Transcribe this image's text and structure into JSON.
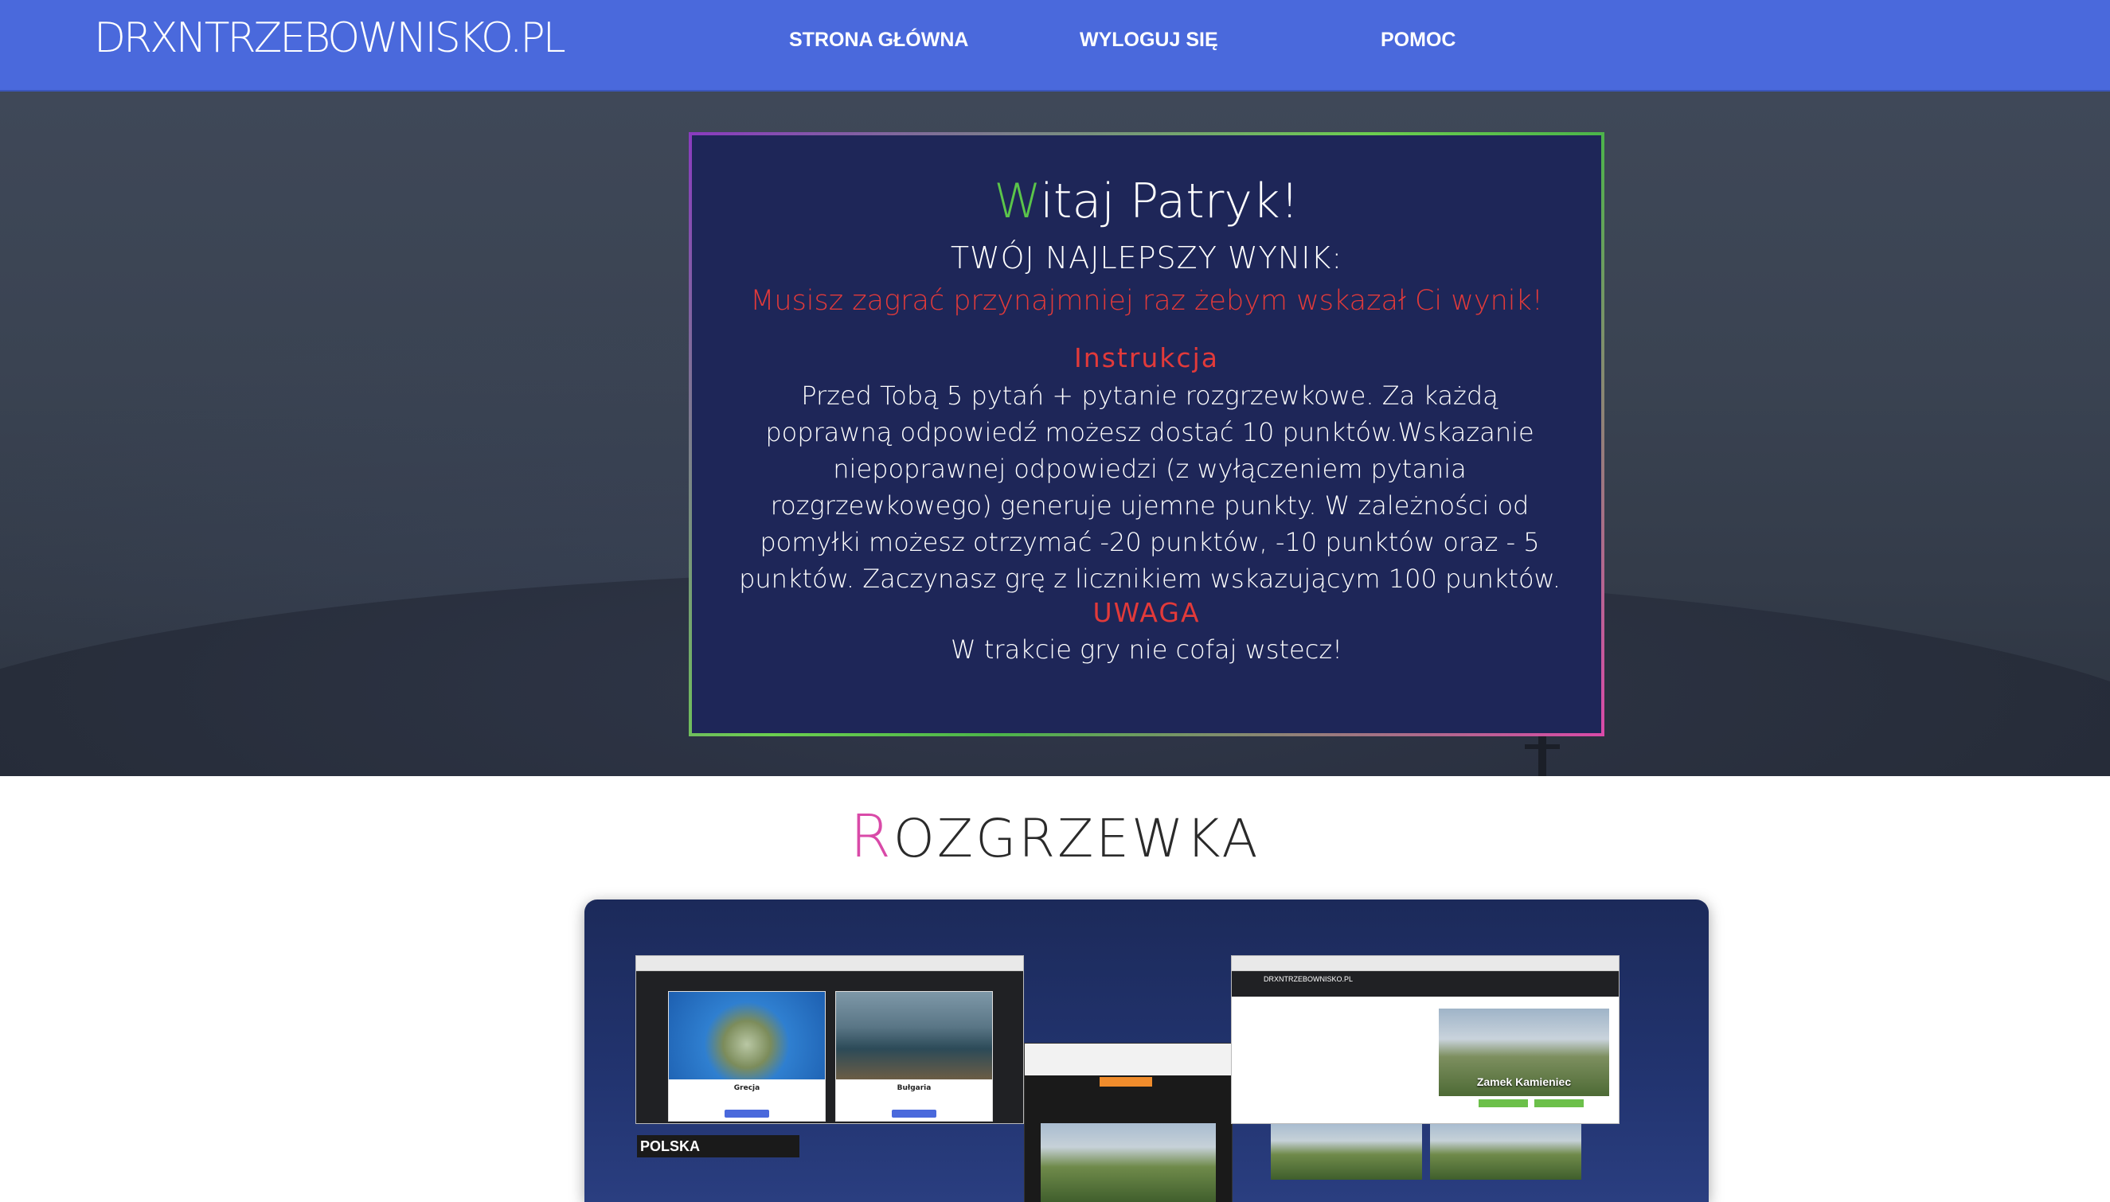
{
  "navbar": {
    "logo": "DRXNTRZEBOWNISKO.PL",
    "links": [
      "STRONA GŁÓWNA",
      "WYLOGUJ SIĘ",
      "POMOC"
    ],
    "accent": "#4a69dc"
  },
  "welcome": {
    "title_first": "W",
    "title_rest": "itaj Patryk!",
    "best_label": "TWÓJ NAJLEPSZY WYNIK:",
    "best_msg": "Musisz zagrać przynajmniej raz żebym wskazał Ci wynik!",
    "instr_heading": "Instrukcja",
    "instr_text": "Przed Tobą 5 pytań + pytanie rozgrzewkowe. Za każdą poprawną odpowiedź możesz dostać 10 punktów.Wskazanie niepoprawnej odpowiedzi (z wyłączeniem pytania rozgrzewkowego) generuje ujemne punkty. W zależności od pomyłki możesz otrzymać -20 punktów, -10 punktów oraz - 5 punktów. Zaczynasz grę z licznikiem wskazującym 100 punktów.",
    "warn_heading": "UWAGA",
    "warn_text": "W trakcie gry nie cofaj wstecz!",
    "colors": {
      "card_bg": "#1e2658",
      "highlight_red": "#e23a3a",
      "green": "#5bc54a"
    }
  },
  "section": {
    "title_first": "R",
    "title_rest": "OZGRZEWKA",
    "accent": "#d94aa8"
  },
  "gallery": {
    "left_cards": [
      "Grecja",
      "Bułgaria"
    ],
    "polska_label": "POLSKA",
    "right_logo": "DRXNTRZEBOWNISKO.PL",
    "right_image_label": "Zamek Kamieniec"
  }
}
